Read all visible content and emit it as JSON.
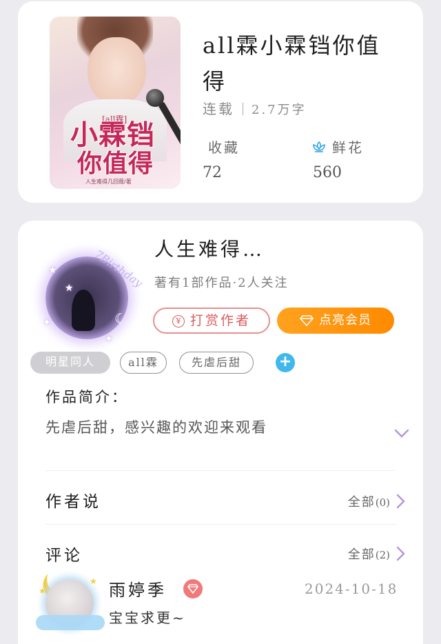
{
  "book": {
    "title": "all霖小霖铛你值得",
    "status": "连载",
    "word_count": "2.7万字",
    "collect_label": "收藏",
    "collect_value": "72",
    "flower_label": "鲜花",
    "flower_value": "560",
    "cover": {
      "tag": "[all霖]",
      "title_line1": "小霖铛",
      "title_line2": "你值得",
      "author_small": "人生难得几回蔻/著"
    }
  },
  "author": {
    "name": "人生难得…",
    "meta": "著有1部作品·2人关注",
    "reward_label": "打赏作者",
    "reward_icon": "¥",
    "vip_label": "点亮会员",
    "avatar_text": "7Birthday"
  },
  "tags": [
    "明星同人",
    "all霖",
    "先虐后甜"
  ],
  "intro": {
    "label": "作品简介：",
    "text": "先虐后甜，感兴趣的欢迎来观看"
  },
  "author_says": {
    "label": "作者说",
    "all_label": "全部",
    "count": "(0)"
  },
  "comments": {
    "label": "评论",
    "all_label": "全部",
    "count": "(2)",
    "items": [
      {
        "user": "雨婷季",
        "date": "2024-10-18",
        "text": "宝宝求更~"
      }
    ]
  },
  "colors": {
    "accent_orange": "#ff8a00",
    "reward_red": "#d85c5c",
    "add_blue": "#3fb8ec",
    "chevron_purple": "#b694d8"
  }
}
